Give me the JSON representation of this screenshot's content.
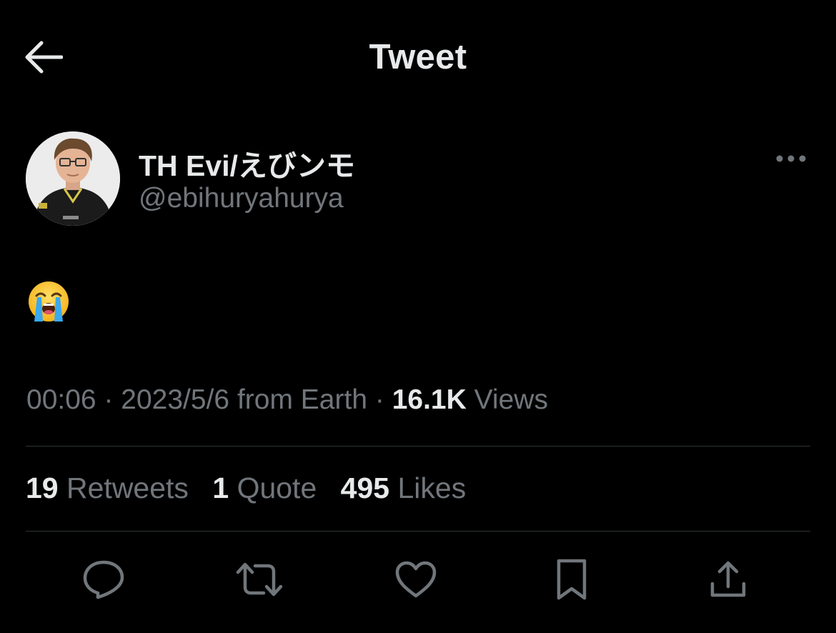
{
  "header": {
    "title": "Tweet",
    "back_icon": "arrow-left-icon"
  },
  "author": {
    "display_name": "TH Evi/えびンモ",
    "handle": "@ebihuryahurya",
    "avatar_icon": "avatar-photo"
  },
  "tweet": {
    "content_emoji": "loudly-crying-face-emoji"
  },
  "meta": {
    "time": "00:06",
    "separator": "·",
    "date": "2023/5/6",
    "source": "from Earth",
    "views_count": "16.1K",
    "views_label": "Views"
  },
  "stats": {
    "retweets_count": "19",
    "retweets_label": "Retweets",
    "quotes_count": "1",
    "quotes_label": "Quote",
    "likes_count": "495",
    "likes_label": "Likes"
  },
  "actions": [
    "reply-icon",
    "retweet-icon",
    "like-icon",
    "bookmark-icon",
    "share-icon"
  ],
  "colors": {
    "background": "#000000",
    "primary_text": "#e7e9ea",
    "secondary_text": "#71767b",
    "divider": "#2f3336",
    "icon": "#71767b"
  }
}
